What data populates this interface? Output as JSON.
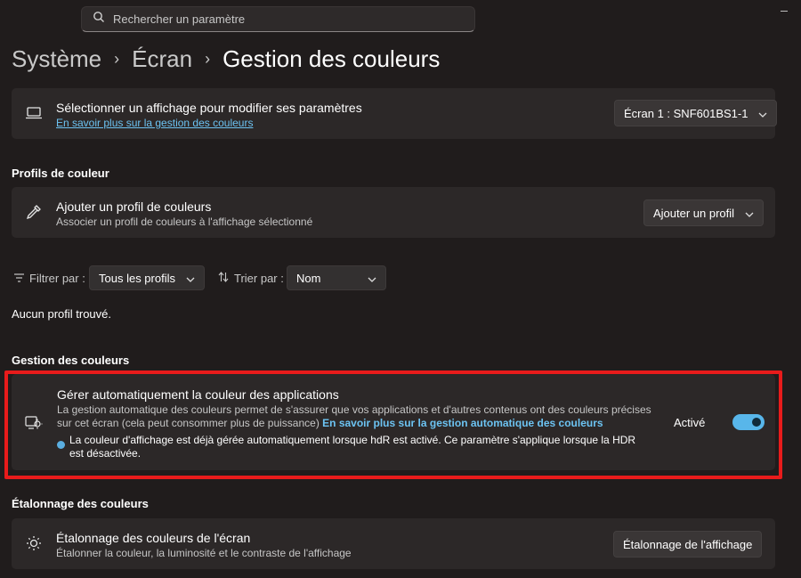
{
  "search": {
    "placeholder": "Rechercher un paramètre",
    "icon": "search-icon"
  },
  "breadcrumb": {
    "items": [
      "Système",
      "Écran"
    ],
    "current": "Gestion des couleurs"
  },
  "display_card": {
    "title": "Sélectionner un affichage pour modifier ses paramètres",
    "link": "En savoir plus sur la gestion des couleurs",
    "dropdown": "Écran 1 : SNF601BS1-1",
    "icon": "laptop-icon"
  },
  "profiles_section": {
    "heading": "Profils de couleur",
    "card_title": "Ajouter un profil de couleurs",
    "card_sub": "Associer un profil de couleurs à l'affichage sélectionné",
    "button": "Ajouter un profil",
    "icon": "eyedropper-icon"
  },
  "filters": {
    "filter_label": "Filtrer par :",
    "filter_value": "Tous les profils",
    "sort_label": "Trier par :",
    "sort_value": "Nom",
    "empty": "Aucun profil trouvé."
  },
  "management_section": {
    "heading": "Gestion des couleurs",
    "title": "Gérer automatiquement la couleur des applications",
    "desc_line1": "La gestion automatique des couleurs permet de s'assurer que vos applications et d'autres contenus ont des couleurs précises",
    "desc_line2": "sur cet écran (cela peut consommer plus de puissance)",
    "desc_link": "En savoir plus sur la gestion automatique des couleurs",
    "note_line1": "La couleur d'affichage est déjà gérée automatiquement lorsque hdR est activé. Ce paramètre s'applique lorsque la HDR",
    "note_line2": "est désactivée.",
    "state": "Activé",
    "toggle_on": true,
    "icon": "monitor-color-icon"
  },
  "calibration_section": {
    "heading": "Étalonnage des couleurs",
    "title": "Étalonnage des couleurs de l'écran",
    "sub": "Étalonner la couleur, la luminosité et le contraste de l'affichage",
    "button": "Étalonnage de l'affichage",
    "icon": "brightness-icon"
  },
  "colors": {
    "accent": "#58b6ea",
    "highlight": "#e81b1b",
    "link": "#6cc3f2"
  }
}
